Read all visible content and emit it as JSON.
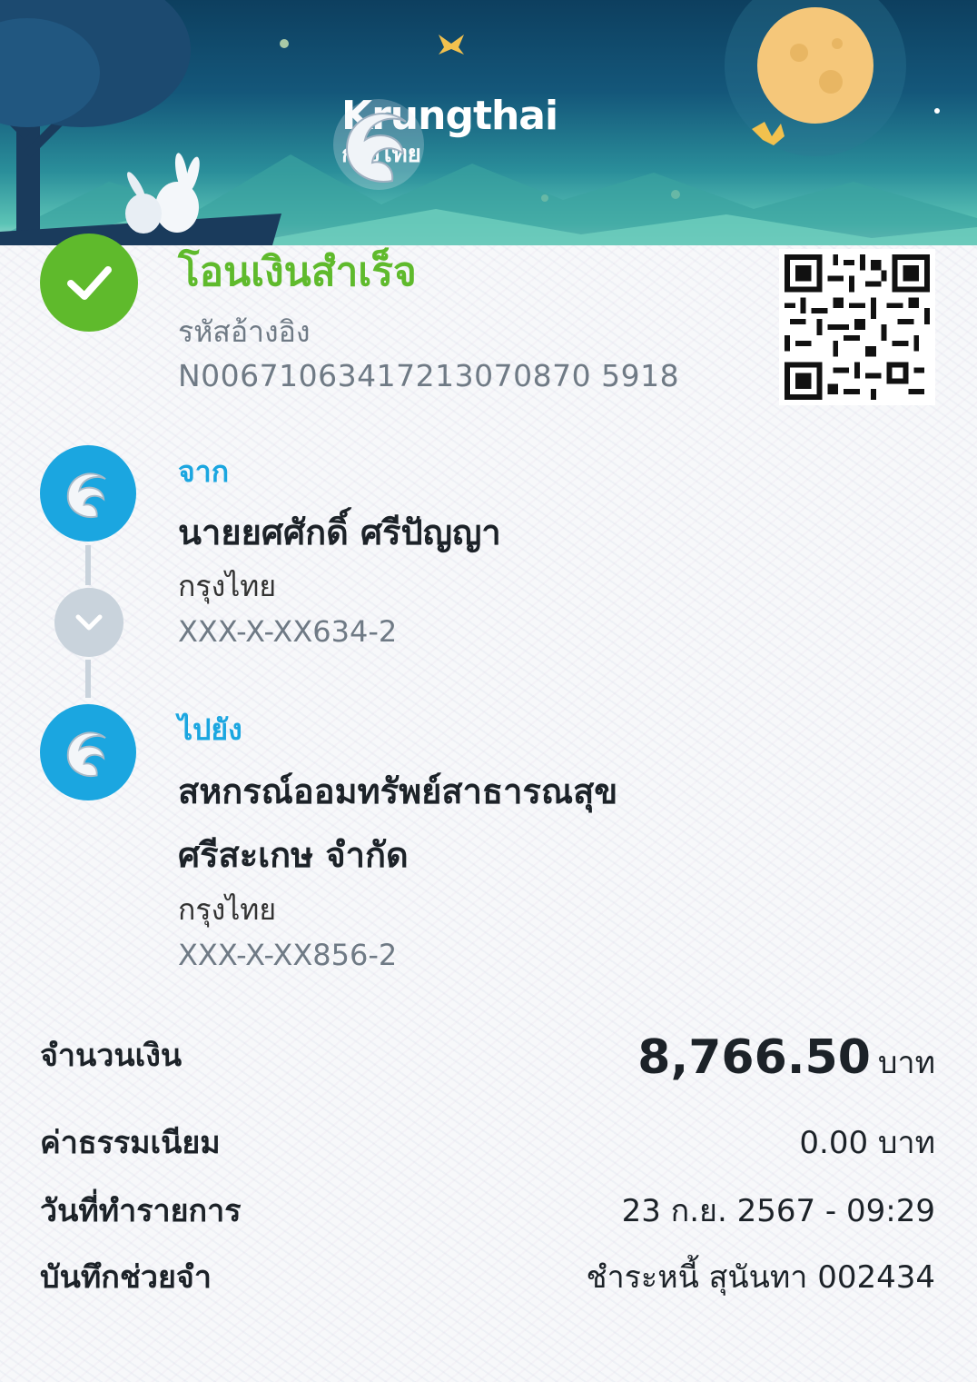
{
  "brand": {
    "name_en": "Krungthai",
    "name_th": "กรุงไทย"
  },
  "status": {
    "title": "โอนเงินสำเร็จ",
    "ref_label": "รหัสอ้างอิง",
    "ref_value": "N00671063417213070870 5918"
  },
  "from": {
    "label": "จาก",
    "name": "นายยศศักดิ์ ศรีปัญญา",
    "bank": "กรุงไทย",
    "account": "XXX-X-XX634-2"
  },
  "to": {
    "label": "ไปยัง",
    "name_line1": "สหกรณ์ออมทรัพย์สาธารณสุข",
    "name_line2": "ศรีสะเกษ จำกัด",
    "bank": "กรุงไทย",
    "account": "XXX-X-XX856-2"
  },
  "details": {
    "amount_label": "จำนวนเงิน",
    "amount_value": "8,766.50",
    "amount_unit": "บาท",
    "fee_label": "ค่าธรรมเนียม",
    "fee_value": "0.00 บาท",
    "date_label": "วันที่ทำรายการ",
    "date_value": "23 ก.ย. 2567 - 09:29",
    "memo_label": "บันทึกช่วยจำ",
    "memo_value": "ชำระหนี้ สุนันทา 002434"
  },
  "colors": {
    "success": "#5fba2c",
    "accent": "#1ba6e0"
  },
  "icons": [
    "check-icon",
    "krungthai-logo",
    "qr-code",
    "chevron-down-icon"
  ]
}
